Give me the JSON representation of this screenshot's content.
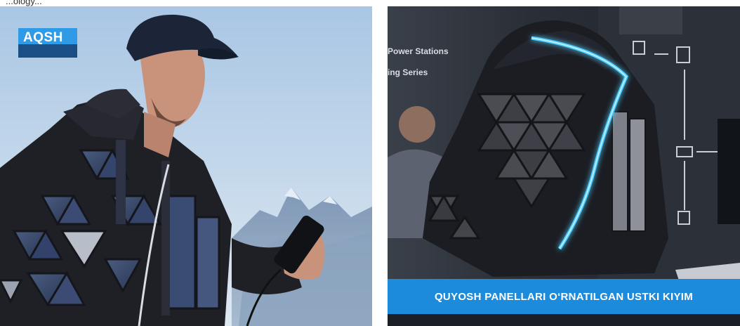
{
  "top_caption": "...ology...",
  "left_photo": {
    "badge": "AQSH"
  },
  "right_photo": {
    "sign_line_1": "Power Stations",
    "sign_line_2": "ing Series",
    "banner": "QUYOSH PANELLARI O‘RNATILGAN USTKI KIYIM"
  }
}
